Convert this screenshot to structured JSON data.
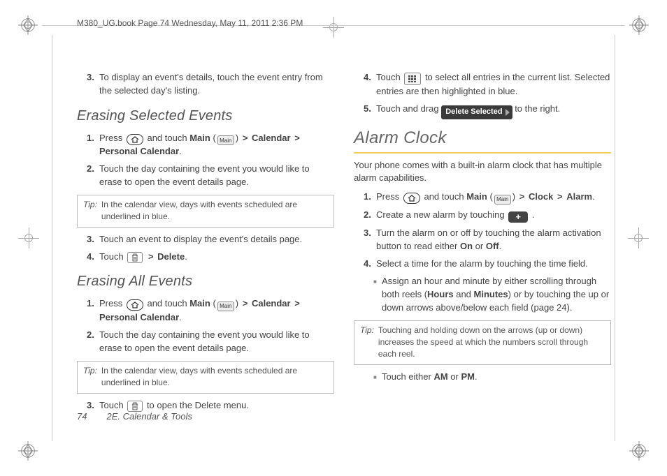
{
  "header": "M380_UG.book  Page 74  Wednesday, May 11, 2011  2:36 PM",
  "footer": {
    "page_num": "74",
    "section": "2E. Calendar & Tools"
  },
  "left": {
    "step3_top": "To display an event's details, touch the event entry from the selected day's listing.",
    "h_erase_sel": "Erasing Selected Events",
    "es1_a": "Press ",
    "es1_b": " and touch ",
    "es1_main": "Main",
    "es1_c": " (",
    "es1_d": ")",
    "es1_cal": "Calendar",
    "es1_pc": "Personal Calendar",
    "es2": "Touch the day containing the event you would like to erase to open the event details page.",
    "tip1_lbl": "Tip:",
    "tip1": "In the calendar view, days with events scheduled are underlined in blue.",
    "es3": "Touch an event to display the event's details page.",
    "es4_a": "Touch ",
    "es4_del": "Delete",
    "h_erase_all": "Erasing All Events",
    "ea1_a": "Press ",
    "ea1_b": " and touch ",
    "ea1_main": "Main",
    "ea1_cal": "Calendar",
    "ea1_pc": "Personal Calendar",
    "ea2": "Touch the day containing the event you would like to erase to open the event details page.",
    "tip2_lbl": "Tip:",
    "tip2": "In the calendar view, days with events scheduled are underlined in blue.",
    "ea3_a": "Touch ",
    "ea3_b": " to open the Delete menu."
  },
  "right": {
    "r4_a": "Touch ",
    "r4_b": " to select all entries in the current list. Selected entries are then highlighted in blue.",
    "r5_a": "Touch and drag ",
    "r5_btn": "Delete Selected",
    "r5_b": " to the right.",
    "h_alarm": "Alarm Clock",
    "intro": "Your phone comes with a built-in alarm clock that has multiple alarm capabilities.",
    "a1_a": "Press ",
    "a1_b": " and touch ",
    "a1_main": "Main",
    "a1_clock": "Clock",
    "a1_alarm": "Alarm",
    "a2_a": "Create a new alarm by touching ",
    "a3_a": "Turn the alarm on or off by touching the alarm activation button to read either ",
    "a3_on": "On",
    "a3_or": " or ",
    "a3_off": "Off",
    "a4": "Select a time for the alarm by touching the time field.",
    "a4_sub_a": "Assign an hour and minute by either scrolling through both reels (",
    "a4_hours": "Hours",
    "a4_and": " and ",
    "a4_minutes": "Minutes",
    "a4_sub_b": ") or by touching the up or down arrows above/below each field (page 24).",
    "tip3_lbl": "Tip:",
    "tip3": "Touching and holding down on the arrows (up or down) increases the speed at which the numbers scroll through each reel.",
    "a4_sub2_a": "Touch either ",
    "a4_am": "AM",
    "a4_or2": " or ",
    "a4_pm": "PM"
  }
}
